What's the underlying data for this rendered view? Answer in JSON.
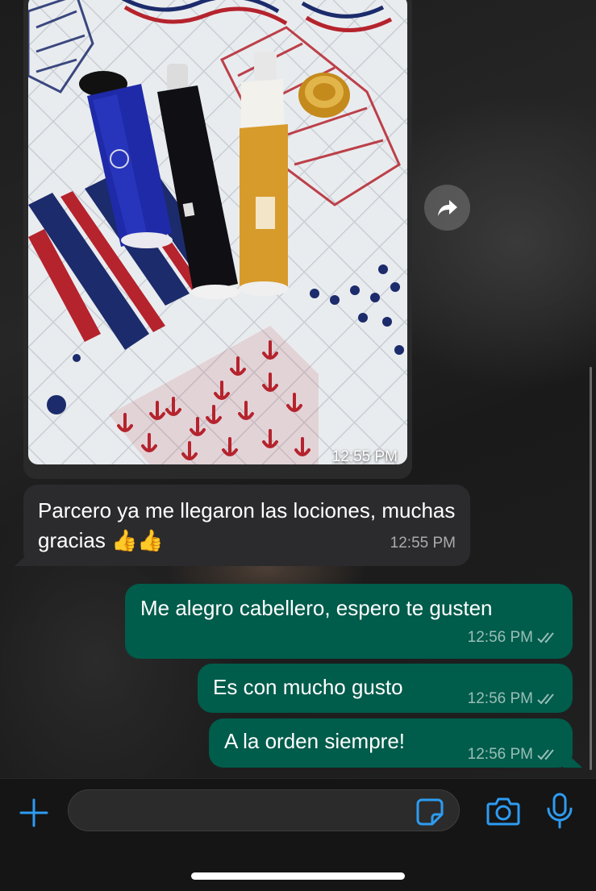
{
  "theme": {
    "incoming_bubble": "#2b2b2d",
    "outgoing_bubble": "#005c4b",
    "accent": "#2d9cf2",
    "background": "#0b0b0b"
  },
  "messages": [
    {
      "direction": "incoming",
      "type": "image",
      "image_alt": "Three perfume spray bottles (blue, black, gold) and a gold cap on a white quilt with red anchors and navy stripes",
      "time": "12:55 PM"
    },
    {
      "direction": "incoming",
      "type": "text",
      "text": "Parcero ya me llegaron las lociones, muchas gracias 👍👍",
      "time": "12:55 PM"
    },
    {
      "direction": "outgoing",
      "type": "text",
      "text": "Me alegro cabellero, espero te gusten",
      "time": "12:56 PM",
      "status": "read"
    },
    {
      "direction": "outgoing",
      "type": "text",
      "text": "Es con mucho gusto",
      "time": "12:56 PM",
      "status": "read"
    },
    {
      "direction": "outgoing",
      "type": "text",
      "text": "A la orden siempre!",
      "time": "12:56 PM",
      "status": "read"
    }
  ],
  "input_bar": {
    "placeholder": "",
    "icons": [
      "plus-icon",
      "sticker-icon",
      "camera-icon",
      "microphone-icon"
    ]
  },
  "forward_icon": "forward-arrow-icon"
}
